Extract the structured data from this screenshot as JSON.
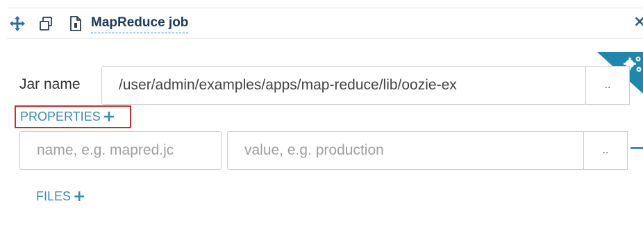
{
  "header": {
    "title": "MapReduce job",
    "close_glyph": "×",
    "icons": [
      "move-icon",
      "copy-icon",
      "document-icon"
    ]
  },
  "jar": {
    "label": "Jar name",
    "value": "/user/admin/examples/apps/map-reduce/lib/oozie-ex",
    "browse_label": ".."
  },
  "properties": {
    "label": "PROPERTIES",
    "add_glyph": "+",
    "name_placeholder": "name, e.g. mapred.jc",
    "value_placeholder": "value, e.g. production",
    "browse_label": ".."
  },
  "files": {
    "label": "FILES",
    "add_glyph": "+"
  },
  "colors": {
    "accent": "#338bb8",
    "corner_badge": "#1d87ad",
    "highlight": "#d9262b",
    "title": "#1e3a5a"
  },
  "corner_badge_icon": "gears-icon"
}
